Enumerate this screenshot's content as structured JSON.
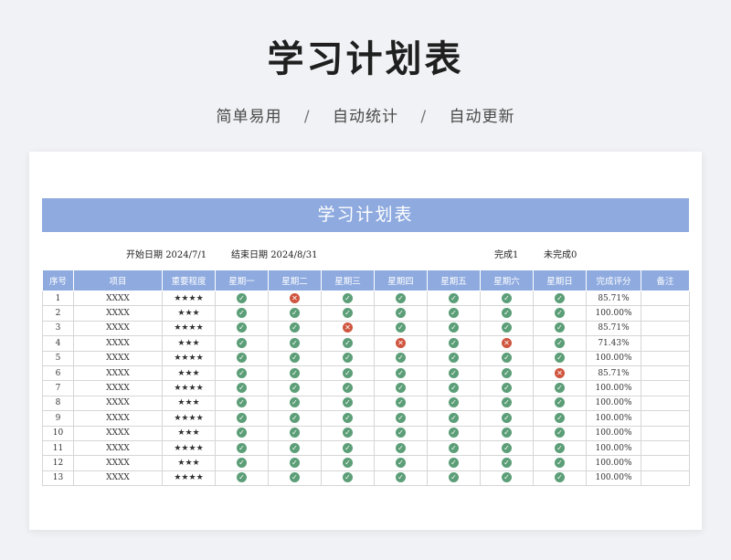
{
  "title": "学习计划表",
  "subtitle": {
    "items": [
      "简单易用",
      "自动统计",
      "自动更新"
    ],
    "separator": "/"
  },
  "sheet": {
    "title": "学习计划表",
    "start_label": "开始日期",
    "start_date": "2024/7/1",
    "end_label": "结束日期",
    "end_date": "2024/8/31",
    "done_label": "完成1",
    "undone_label": "未完成0"
  },
  "table": {
    "headers": [
      "序号",
      "项目",
      "重要程度",
      "星期一",
      "星期二",
      "星期三",
      "星期四",
      "星期五",
      "星期六",
      "星期日",
      "完成评分",
      "备注"
    ],
    "rows": [
      {
        "no": "1",
        "item": "XXXX",
        "stars": "★★★★",
        "days": [
          1,
          0,
          1,
          1,
          1,
          1,
          1
        ],
        "score": "85.71%"
      },
      {
        "no": "2",
        "item": "XXXX",
        "stars": "★★★",
        "days": [
          1,
          1,
          1,
          1,
          1,
          1,
          1
        ],
        "score": "100.00%"
      },
      {
        "no": "3",
        "item": "XXXX",
        "stars": "★★★★",
        "days": [
          1,
          1,
          0,
          1,
          1,
          1,
          1
        ],
        "score": "85.71%"
      },
      {
        "no": "4",
        "item": "XXXX",
        "stars": "★★★",
        "days": [
          1,
          1,
          1,
          0,
          1,
          0,
          1
        ],
        "score": "71.43%"
      },
      {
        "no": "5",
        "item": "XXXX",
        "stars": "★★★★",
        "days": [
          1,
          1,
          1,
          1,
          1,
          1,
          1
        ],
        "score": "100.00%"
      },
      {
        "no": "6",
        "item": "XXXX",
        "stars": "★★★",
        "days": [
          1,
          1,
          1,
          1,
          1,
          1,
          0
        ],
        "score": "85.71%"
      },
      {
        "no": "7",
        "item": "XXXX",
        "stars": "★★★★",
        "days": [
          1,
          1,
          1,
          1,
          1,
          1,
          1
        ],
        "score": "100.00%"
      },
      {
        "no": "8",
        "item": "XXXX",
        "stars": "★★★",
        "days": [
          1,
          1,
          1,
          1,
          1,
          1,
          1
        ],
        "score": "100.00%"
      },
      {
        "no": "9",
        "item": "XXXX",
        "stars": "★★★★",
        "days": [
          1,
          1,
          1,
          1,
          1,
          1,
          1
        ],
        "score": "100.00%"
      },
      {
        "no": "10",
        "item": "XXXX",
        "stars": "★★★",
        "days": [
          1,
          1,
          1,
          1,
          1,
          1,
          1
        ],
        "score": "100.00%"
      },
      {
        "no": "11",
        "item": "XXXX",
        "stars": "★★★★",
        "days": [
          1,
          1,
          1,
          1,
          1,
          1,
          1
        ],
        "score": "100.00%"
      },
      {
        "no": "12",
        "item": "XXXX",
        "stars": "★★★",
        "days": [
          1,
          1,
          1,
          1,
          1,
          1,
          1
        ],
        "score": "100.00%"
      },
      {
        "no": "13",
        "item": "XXXX",
        "stars": "★★★★",
        "days": [
          1,
          1,
          1,
          1,
          1,
          1,
          1
        ],
        "score": "100.00%"
      }
    ]
  },
  "icons": {
    "done": "check-circle-icon",
    "not_done": "x-circle-icon"
  },
  "colors": {
    "header": "#8eaadf",
    "done": "#5b9e77",
    "not_done": "#d0553f"
  }
}
